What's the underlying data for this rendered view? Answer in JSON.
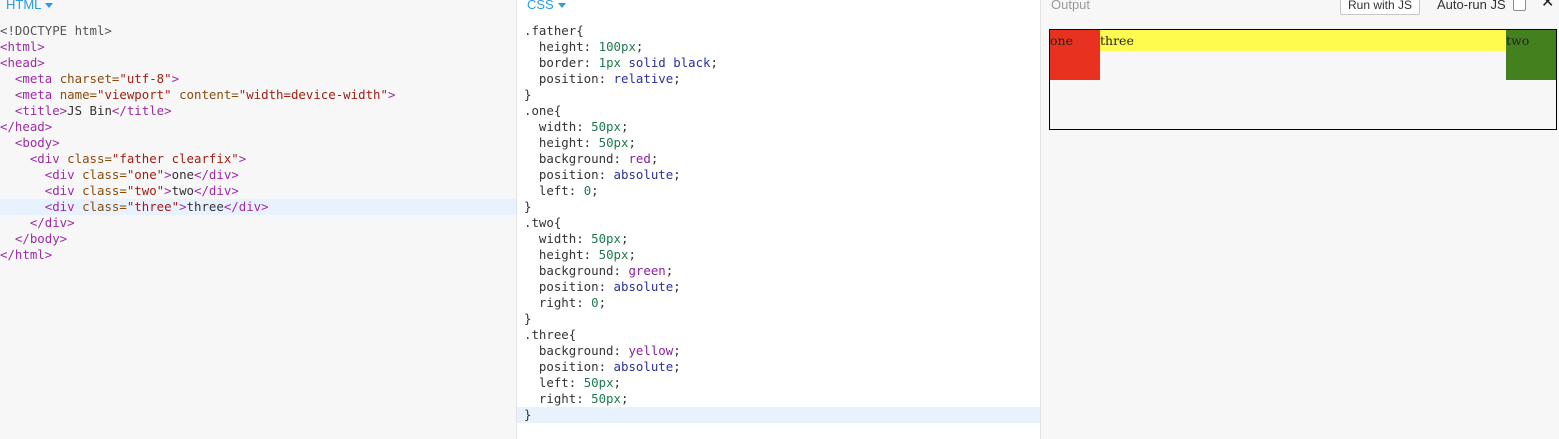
{
  "html_panel": {
    "label": "HTML",
    "lines": [
      {
        "segments": [
          {
            "c": "doctype",
            "t": "<!DOCTYPE html>"
          }
        ]
      },
      {
        "segments": [
          {
            "c": "tag",
            "t": "<html>"
          }
        ]
      },
      {
        "segments": [
          {
            "c": "tag",
            "t": "<head>"
          }
        ]
      },
      {
        "segments": [
          {
            "c": "text",
            "t": "  "
          },
          {
            "c": "tag",
            "t": "<meta "
          },
          {
            "c": "attr",
            "t": "charset="
          },
          {
            "c": "str",
            "t": "\"utf-8\""
          },
          {
            "c": "tag",
            "t": ">"
          }
        ]
      },
      {
        "segments": [
          {
            "c": "text",
            "t": "  "
          },
          {
            "c": "tag",
            "t": "<meta "
          },
          {
            "c": "attr",
            "t": "name="
          },
          {
            "c": "str",
            "t": "\"viewport\""
          },
          {
            "c": "attr",
            "t": " content="
          },
          {
            "c": "str",
            "t": "\"width=device-width\""
          },
          {
            "c": "tag",
            "t": ">"
          }
        ]
      },
      {
        "segments": [
          {
            "c": "text",
            "t": "  "
          },
          {
            "c": "tag",
            "t": "<title>"
          },
          {
            "c": "text",
            "t": "JS Bin"
          },
          {
            "c": "tag",
            "t": "</title>"
          }
        ]
      },
      {
        "segments": [
          {
            "c": "tag",
            "t": "</head>"
          }
        ]
      },
      {
        "segments": [
          {
            "c": "text",
            "t": "  "
          },
          {
            "c": "tag",
            "t": "<body>"
          }
        ]
      },
      {
        "segments": [
          {
            "c": "text",
            "t": "    "
          },
          {
            "c": "tag",
            "t": "<div "
          },
          {
            "c": "attr",
            "t": "class="
          },
          {
            "c": "str",
            "t": "\"father clearfix\""
          },
          {
            "c": "tag",
            "t": ">"
          }
        ]
      },
      {
        "segments": [
          {
            "c": "text",
            "t": "      "
          },
          {
            "c": "tag",
            "t": "<div "
          },
          {
            "c": "attr",
            "t": "class="
          },
          {
            "c": "str",
            "t": "\"one\""
          },
          {
            "c": "tag",
            "t": ">"
          },
          {
            "c": "text",
            "t": "one"
          },
          {
            "c": "tag",
            "t": "</div>"
          }
        ]
      },
      {
        "segments": [
          {
            "c": "text",
            "t": "      "
          },
          {
            "c": "tag",
            "t": "<div "
          },
          {
            "c": "attr",
            "t": "class="
          },
          {
            "c": "str",
            "t": "\"two\""
          },
          {
            "c": "tag",
            "t": ">"
          },
          {
            "c": "text",
            "t": "two"
          },
          {
            "c": "tag",
            "t": "</div>"
          }
        ]
      },
      {
        "active": true,
        "segments": [
          {
            "c": "text",
            "t": "      "
          },
          {
            "c": "tag",
            "t": "<div "
          },
          {
            "c": "attr",
            "t": "class="
          },
          {
            "c": "str",
            "t": "\"three\""
          },
          {
            "c": "tag",
            "t": ">"
          },
          {
            "c": "text",
            "t": "three"
          },
          {
            "c": "tag",
            "t": "</div>"
          }
        ]
      },
      {
        "segments": [
          {
            "c": "text",
            "t": "    "
          },
          {
            "c": "tag",
            "t": "</div>"
          }
        ]
      },
      {
        "segments": [
          {
            "c": "text",
            "t": "  "
          },
          {
            "c": "tag",
            "t": "</body>"
          }
        ]
      },
      {
        "segments": [
          {
            "c": "tag",
            "t": "</html>"
          }
        ]
      }
    ]
  },
  "css_panel": {
    "label": "CSS",
    "lines": [
      {
        "segments": [
          {
            "c": "sel",
            "t": ".father{"
          }
        ]
      },
      {
        "segments": [
          {
            "c": "prop",
            "t": "  height: "
          },
          {
            "c": "num",
            "t": "100px"
          },
          {
            "c": "punc",
            "t": ";"
          }
        ]
      },
      {
        "segments": [
          {
            "c": "prop",
            "t": "  border: "
          },
          {
            "c": "num",
            "t": "1px"
          },
          {
            "c": "kw",
            "t": " solid black"
          },
          {
            "c": "punc",
            "t": ";"
          }
        ]
      },
      {
        "segments": [
          {
            "c": "prop",
            "t": "  position: "
          },
          {
            "c": "kw",
            "t": "relative"
          },
          {
            "c": "punc",
            "t": ";"
          }
        ]
      },
      {
        "segments": [
          {
            "c": "punc",
            "t": "}"
          }
        ]
      },
      {
        "segments": [
          {
            "c": "sel",
            "t": ".one{"
          }
        ]
      },
      {
        "segments": [
          {
            "c": "prop",
            "t": "  width: "
          },
          {
            "c": "num",
            "t": "50px"
          },
          {
            "c": "punc",
            "t": ";"
          }
        ]
      },
      {
        "segments": [
          {
            "c": "prop",
            "t": "  height: "
          },
          {
            "c": "num",
            "t": "50px"
          },
          {
            "c": "punc",
            "t": ";"
          }
        ]
      },
      {
        "segments": [
          {
            "c": "prop",
            "t": "  background: "
          },
          {
            "c": "col",
            "t": "red"
          },
          {
            "c": "punc",
            "t": ";"
          }
        ]
      },
      {
        "segments": [
          {
            "c": "prop",
            "t": "  position: "
          },
          {
            "c": "kw",
            "t": "absolute"
          },
          {
            "c": "punc",
            "t": ";"
          }
        ]
      },
      {
        "segments": [
          {
            "c": "prop",
            "t": "  left: "
          },
          {
            "c": "num",
            "t": "0"
          },
          {
            "c": "punc",
            "t": ";"
          }
        ]
      },
      {
        "segments": [
          {
            "c": "punc",
            "t": "}"
          }
        ]
      },
      {
        "segments": [
          {
            "c": "sel",
            "t": ".two{"
          }
        ]
      },
      {
        "segments": [
          {
            "c": "prop",
            "t": "  width: "
          },
          {
            "c": "num",
            "t": "50px"
          },
          {
            "c": "punc",
            "t": ";"
          }
        ]
      },
      {
        "segments": [
          {
            "c": "prop",
            "t": "  height: "
          },
          {
            "c": "num",
            "t": "50px"
          },
          {
            "c": "punc",
            "t": ";"
          }
        ]
      },
      {
        "segments": [
          {
            "c": "prop",
            "t": "  background: "
          },
          {
            "c": "col",
            "t": "green"
          },
          {
            "c": "punc",
            "t": ";"
          }
        ]
      },
      {
        "segments": [
          {
            "c": "prop",
            "t": "  position: "
          },
          {
            "c": "kw",
            "t": "absolute"
          },
          {
            "c": "punc",
            "t": ";"
          }
        ]
      },
      {
        "segments": [
          {
            "c": "prop",
            "t": "  right: "
          },
          {
            "c": "num",
            "t": "0"
          },
          {
            "c": "punc",
            "t": ";"
          }
        ]
      },
      {
        "segments": [
          {
            "c": "punc",
            "t": "}"
          }
        ]
      },
      {
        "segments": [
          {
            "c": "sel",
            "t": ".three{"
          }
        ]
      },
      {
        "segments": [
          {
            "c": "prop",
            "t": "  background: "
          },
          {
            "c": "col",
            "t": "yellow"
          },
          {
            "c": "punc",
            "t": ";"
          }
        ]
      },
      {
        "segments": [
          {
            "c": "prop",
            "t": "  position: "
          },
          {
            "c": "kw",
            "t": "absolute"
          },
          {
            "c": "punc",
            "t": ";"
          }
        ]
      },
      {
        "segments": [
          {
            "c": "prop",
            "t": "  left: "
          },
          {
            "c": "num",
            "t": "50px"
          },
          {
            "c": "punc",
            "t": ";"
          }
        ]
      },
      {
        "segments": [
          {
            "c": "prop",
            "t": "  right: "
          },
          {
            "c": "num",
            "t": "50px"
          },
          {
            "c": "punc",
            "t": ";"
          }
        ]
      },
      {
        "active": true,
        "segments": [
          {
            "c": "punc",
            "t": "}"
          }
        ]
      }
    ]
  },
  "output_panel": {
    "label": "Output",
    "run_button": "Run with JS",
    "autorun_label": "Auto-run JS",
    "autorun_checked": false,
    "close_glyph": "✕",
    "preview": {
      "one": "one",
      "two": "two",
      "three": "three"
    }
  },
  "colors": {
    "label_blue": "#2a9be6",
    "red": "#e8321f",
    "green": "#43811e",
    "yellow": "#fefb4e"
  }
}
